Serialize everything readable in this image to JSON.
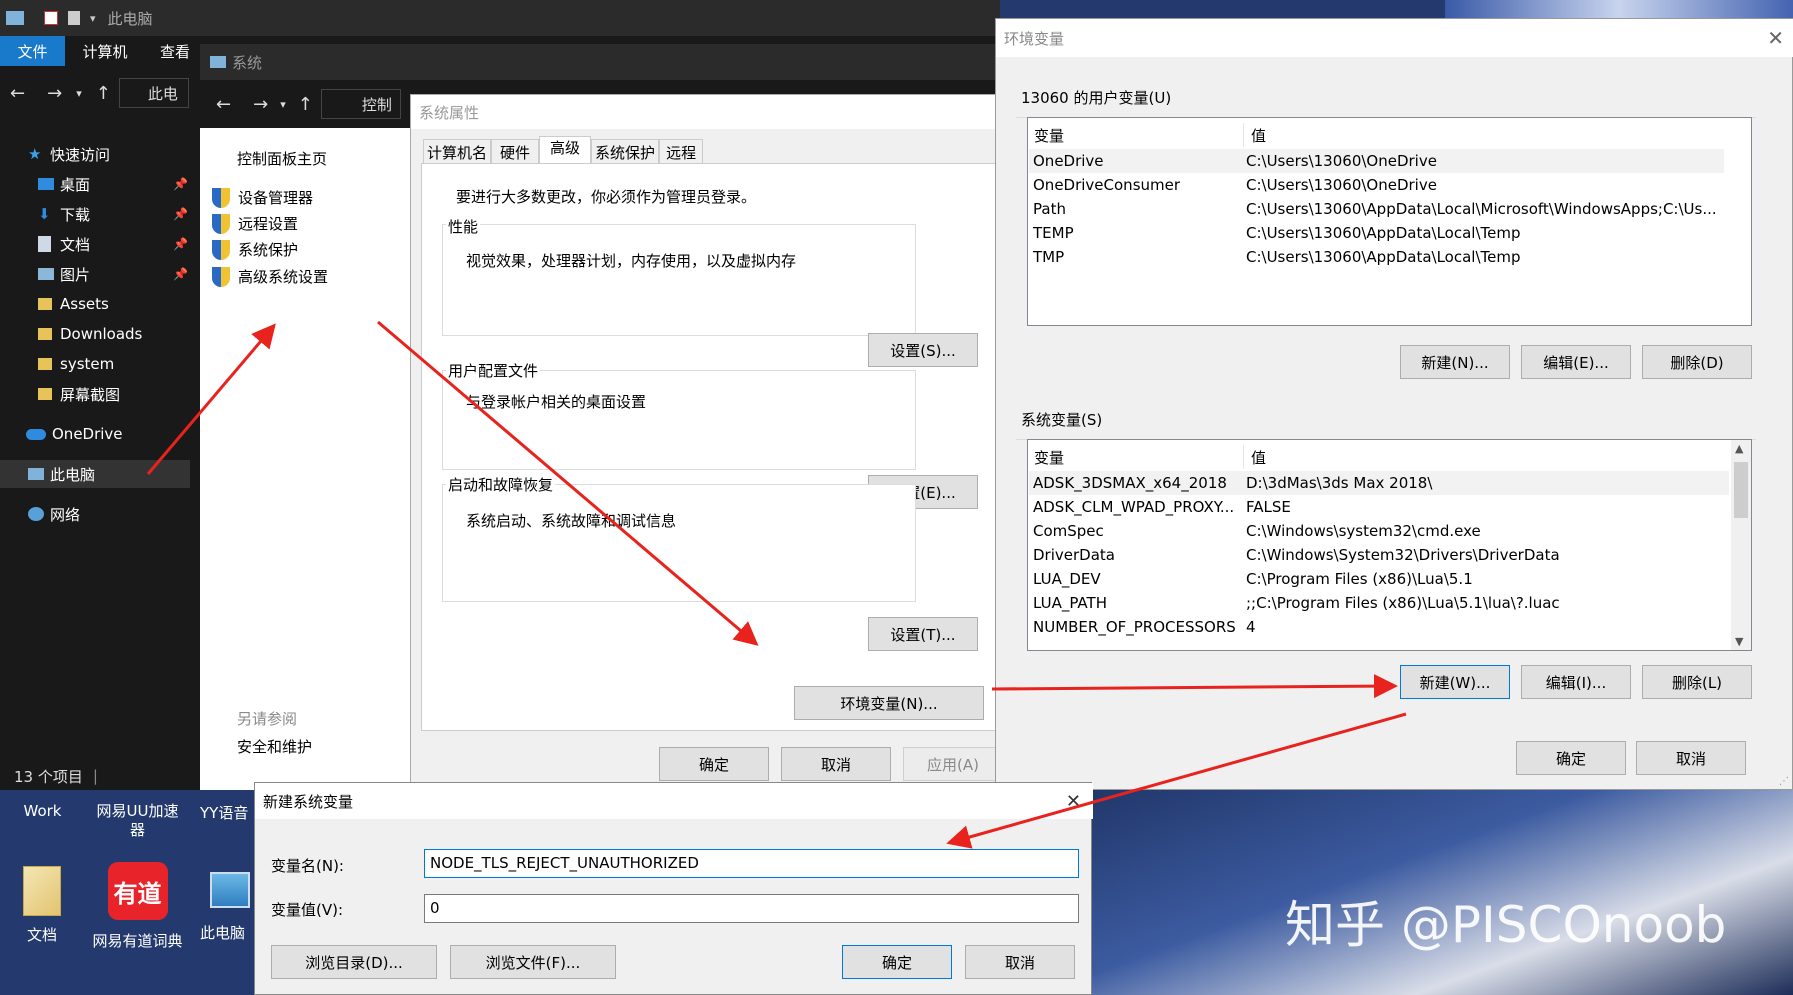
{
  "explorer": {
    "title": "此电脑",
    "ribbon_tabs": [
      "文件",
      "计算机",
      "查看"
    ],
    "address": "此电",
    "nav": [
      {
        "label": "快速访问",
        "icon": "star-icon"
      },
      {
        "label": "桌面",
        "icon": "desktop-icon",
        "pinned": true
      },
      {
        "label": "下载",
        "icon": "download-icon",
        "pinned": true
      },
      {
        "label": "文档",
        "icon": "document-icon",
        "pinned": true
      },
      {
        "label": "图片",
        "icon": "picture-icon",
        "pinned": true
      },
      {
        "label": "Assets",
        "icon": "folder-icon"
      },
      {
        "label": "Downloads",
        "icon": "folder-icon"
      },
      {
        "label": "system",
        "icon": "folder-icon"
      },
      {
        "label": "屏幕截图",
        "icon": "folder-icon"
      },
      {
        "label": "OneDrive",
        "icon": "cloud-icon"
      },
      {
        "label": "此电脑",
        "icon": "computer-icon"
      },
      {
        "label": "网络",
        "icon": "network-icon"
      }
    ],
    "status": "13 个项目"
  },
  "system": {
    "title": "系统",
    "address": "控制",
    "cp_home": "控制面板主页",
    "links": [
      "设备管理器",
      "远程设置",
      "系统保护",
      "高级系统设置"
    ],
    "see_also": "另请参阅",
    "security": "安全和维护"
  },
  "sysprops": {
    "title": "系统属性",
    "tabs": [
      "计算机名",
      "硬件",
      "高级",
      "系统保护",
      "远程"
    ],
    "intro": "要进行大多数更改，你必须作为管理员登录。",
    "perf_title": "性能",
    "perf_desc": "视觉效果，处理器计划，内存使用，以及虚拟内存",
    "perf_btn": "设置(S)...",
    "profile_title": "用户配置文件",
    "profile_desc": "与登录帐户相关的桌面设置",
    "profile_btn": "设置(E)...",
    "startup_title": "启动和故障恢复",
    "startup_desc": "系统启动、系统故障和调试信息",
    "startup_btn": "设置(T)...",
    "env_btn": "环境变量(N)...",
    "ok": "确定",
    "cancel": "取消",
    "apply": "应用(A)"
  },
  "envvars": {
    "title": "环境变量",
    "user_group": "13060 的用户变量(U)",
    "col_var": "变量",
    "col_val": "值",
    "user_vars": [
      {
        "name": "OneDrive",
        "value": "C:\\Users\\13060\\OneDrive"
      },
      {
        "name": "OneDriveConsumer",
        "value": "C:\\Users\\13060\\OneDrive"
      },
      {
        "name": "Path",
        "value": "C:\\Users\\13060\\AppData\\Local\\Microsoft\\WindowsApps;C:\\Us..."
      },
      {
        "name": "TEMP",
        "value": "C:\\Users\\13060\\AppData\\Local\\Temp"
      },
      {
        "name": "TMP",
        "value": "C:\\Users\\13060\\AppData\\Local\\Temp"
      }
    ],
    "user_new": "新建(N)...",
    "user_edit": "编辑(E)...",
    "user_delete": "删除(D)",
    "sys_group": "系统变量(S)",
    "sys_vars": [
      {
        "name": "ADSK_3DSMAX_x64_2018",
        "value": "D:\\3dMas\\3ds Max 2018\\"
      },
      {
        "name": "ADSK_CLM_WPAD_PROXY...",
        "value": "FALSE"
      },
      {
        "name": "ComSpec",
        "value": "C:\\Windows\\system32\\cmd.exe"
      },
      {
        "name": "DriverData",
        "value": "C:\\Windows\\System32\\Drivers\\DriverData"
      },
      {
        "name": "LUA_DEV",
        "value": "C:\\Program Files (x86)\\Lua\\5.1"
      },
      {
        "name": "LUA_PATH",
        "value": ";;C:\\Program Files (x86)\\Lua\\5.1\\lua\\?.luac"
      },
      {
        "name": "NUMBER_OF_PROCESSORS",
        "value": "4"
      }
    ],
    "sys_new": "新建(W)...",
    "sys_edit": "编辑(I)...",
    "sys_delete": "删除(L)",
    "ok": "确定",
    "cancel": "取消"
  },
  "newvar": {
    "title": "新建系统变量",
    "name_label": "变量名(N):",
    "name_value": "NODE_TLS_REJECT_UNAUTHORIZED",
    "value_label": "变量值(V):",
    "value_value": "0",
    "browse_dir": "浏览目录(D)...",
    "browse_file": "浏览文件(F)...",
    "ok": "确定",
    "cancel": "取消"
  },
  "desktop": {
    "icons_top": [
      "Work",
      "网易UU加速器",
      "YY语音"
    ],
    "icons_bottom": [
      "文档",
      "网易有道词典",
      "此电脑"
    ],
    "youdao_logo": "有道"
  },
  "watermark": "知乎 @PISCOnoob",
  "colors": {
    "accent": "#0078d7",
    "arrow": "#e8231e",
    "dark": "#191919"
  }
}
